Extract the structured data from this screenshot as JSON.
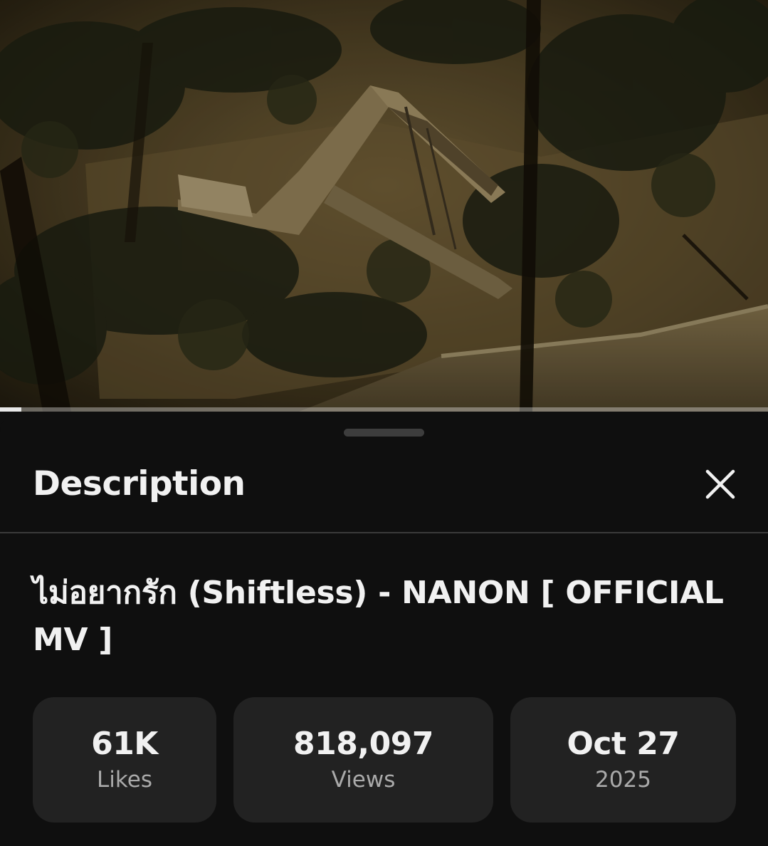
{
  "player": {
    "progress_fraction": 0.028
  },
  "description_panel": {
    "heading": "Description",
    "close_icon": "close-icon",
    "video_title": "ไม่อยากรัก (Shiftless) - NANON [ OFFICIAL MV ]",
    "stats": [
      {
        "value": "61K",
        "label": "Likes"
      },
      {
        "value": "818,097",
        "label": "Views"
      },
      {
        "value": "Oct 27",
        "label": "2025"
      }
    ]
  },
  "colors": {
    "sheet_background": "#0f0f0f",
    "stat_card": "#222222",
    "primary_text": "#f1f1f1",
    "secondary_text": "#aaaaaa"
  }
}
